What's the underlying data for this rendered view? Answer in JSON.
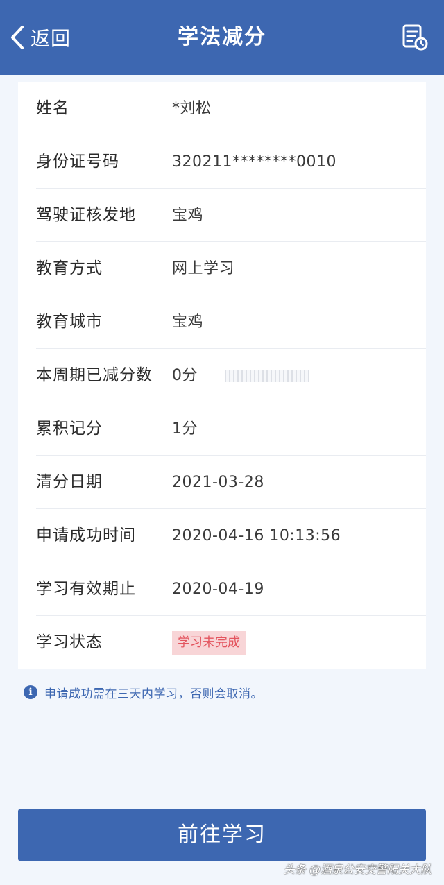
{
  "header": {
    "back_label": "返回",
    "title": "学法减分",
    "record_icon": "document-clock-icon",
    "color": "#3d67b1"
  },
  "fields": [
    {
      "label": "姓名",
      "value": "*刘松"
    },
    {
      "label": "身份证号码",
      "value": "320211********0010"
    },
    {
      "label": "驾驶证核发地",
      "value": "宝鸡"
    },
    {
      "label": "教育方式",
      "value": "网上学习"
    },
    {
      "label": "教育城市",
      "value": "宝鸡"
    },
    {
      "label": "本周期已减分数",
      "value": "0分"
    },
    {
      "label": "累积记分",
      "value": "1分"
    },
    {
      "label": "清分日期",
      "value": "2021-03-28"
    },
    {
      "label": "申请成功时间",
      "value": "2020-04-16 10:13:56"
    },
    {
      "label": "学习有效期止",
      "value": "2020-04-19"
    },
    {
      "label": "学习状态",
      "value": "学习未完成",
      "status_color": "#e3545e"
    }
  ],
  "notice": {
    "icon": "info-icon",
    "text": "申请成功需在三天内学习，否则会取消。"
  },
  "action": {
    "label": "前往学习"
  },
  "watermark": "头条 @酒泉公安交警阳关大队"
}
